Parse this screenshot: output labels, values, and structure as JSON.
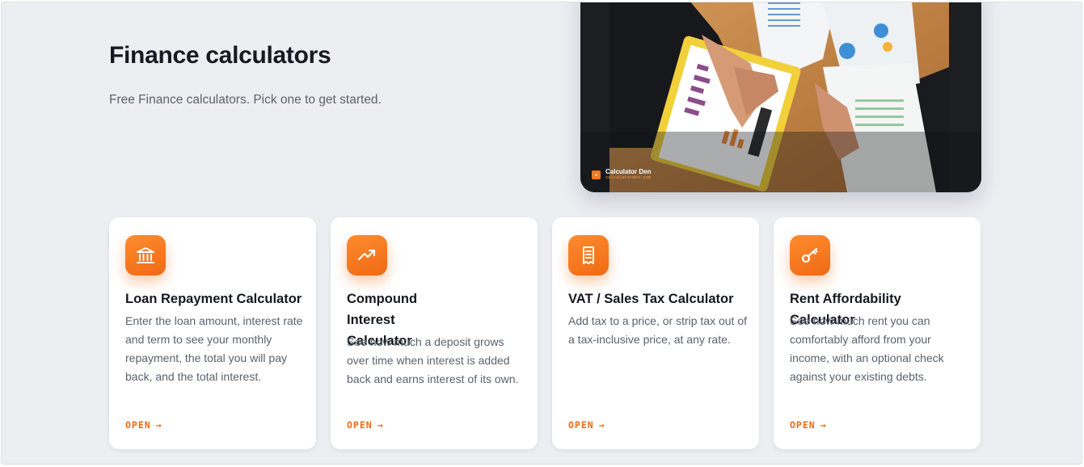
{
  "header": {
    "title": "Finance calculators",
    "subtitle": "Free Finance calculators. Pick one to get started."
  },
  "hero": {
    "brand_name": "Calculator Den",
    "brand_url": "calculatorden.com"
  },
  "cards": [
    {
      "icon": "bank-icon",
      "title": "Loan Repayment Calculator",
      "description": "Enter the loan amount, interest rate and term to see your monthly repayment, the total you will pay back, and the total interest.",
      "link": "OPEN"
    },
    {
      "icon": "trending-up-icon",
      "title": "Compound Interest Calculator",
      "description": "See how much a deposit grows over time when interest is added back and earns interest of its own.",
      "link": "OPEN"
    },
    {
      "icon": "receipt-icon",
      "title": "VAT / Sales Tax Calculator",
      "description": "Add tax to a price, or strip tax out of a tax-inclusive price, at any rate.",
      "link": "OPEN"
    },
    {
      "icon": "key-icon",
      "title": "Rent Affordability Calculator",
      "description": "See how much rent you can comfortably afford from your income, with an optional check against your existing debts.",
      "link": "OPEN"
    }
  ],
  "colors": {
    "accent": "#ef6a14",
    "background": "#eceef2",
    "card": "#ffffff"
  }
}
